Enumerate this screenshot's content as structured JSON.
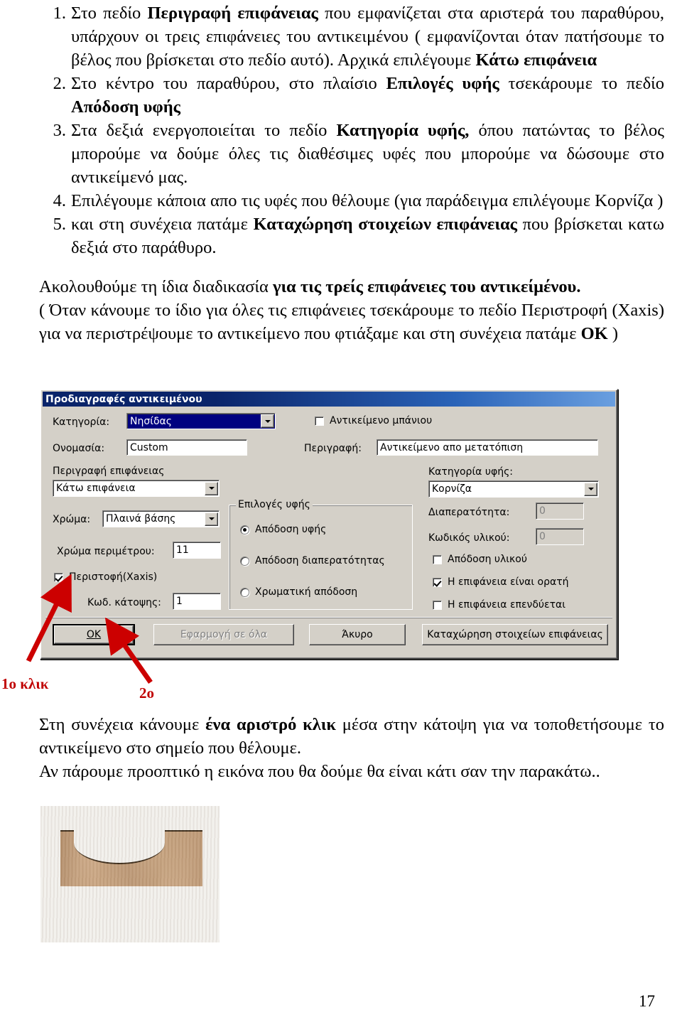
{
  "document": {
    "numbered_items": [
      {
        "number": "1.",
        "segments": [
          {
            "text": "Στο πεδίο ",
            "bold": false
          },
          {
            "text": "Περιγραφή επιφάνειας",
            "bold": true
          },
          {
            "text": " που εμφανίζεται στα αριστερά του παραθύρου, υπάρχουν οι τρεις επιφάνειες του αντικειμένου ( εμφανίζονται όταν πατήσουμε το βέλος που βρίσκεται στο πεδίο αυτό). Αρχικά επιλέγουμε ",
            "bold": false
          },
          {
            "text": "Κάτω επιφάνεια",
            "bold": true
          }
        ]
      },
      {
        "number": "2.",
        "segments": [
          {
            "text": "Στο κέντρο του παραθύρου, στο πλαίσιο ",
            "bold": false
          },
          {
            "text": "Επιλογές υφής",
            "bold": true
          },
          {
            "text": " τσεκάρουμε το πεδίο ",
            "bold": false
          },
          {
            "text": "Απόδοση υφής",
            "bold": true
          }
        ]
      },
      {
        "number": "3.",
        "segments": [
          {
            "text": "Στα δεξιά ενεργοποιείται το πεδίο ",
            "bold": false
          },
          {
            "text": "Κατηγορία υφής,",
            "bold": true
          },
          {
            "text": " όπου πατώντας το βέλος μπορούμε να δούμε όλες τις διαθέσιμες υφές που μπορούμε να δώσουμε στο αντικείμενό μας.",
            "bold": false
          }
        ]
      },
      {
        "number": "4.",
        "segments": [
          {
            "text": "Επιλέγουμε κάποια απο τις υφές που θέλουμε (για παράδειγμα επιλέγουμε Κορνίζα )",
            "bold": false
          }
        ]
      },
      {
        "number": "5.",
        "segments": [
          {
            "text": "και στη συνέχεια πατάμε ",
            "bold": false
          },
          {
            "text": "Καταχώρηση στοιχείων επιφάνειας",
            "bold": true
          },
          {
            "text": " που βρίσκεται κατω δεξιά στο παράθυρο.",
            "bold": false
          }
        ]
      }
    ],
    "paragraph_after_list": [
      {
        "segments": [
          {
            "text": "Ακολουθούμε τη ίδια διαδικασία ",
            "bold": false
          },
          {
            "text": "για τις τρείς επιφάνειες του αντικείμένου.",
            "bold": true
          }
        ]
      },
      {
        "segments": [
          {
            "text": "( Όταν κάνουμε το ίδιο για όλες τις επιφάνειες τσεκάρουμε το πεδίο Περιστροφή (Xaxis) για να περιστρέψουμε το αντικείμενο που φτιάξαμε και στη συνέχεια πατάμε ",
            "bold": false
          },
          {
            "text": "ΟΚ",
            "bold": true
          },
          {
            "text": "  )",
            "bold": false
          }
        ]
      }
    ],
    "paragraph_after_dialog": [
      {
        "segments": [
          {
            "text": "Στη συνέχεια κάνουμε ",
            "bold": false
          },
          {
            "text": "ένα αριστρό κλικ",
            "bold": true
          },
          {
            "text": " μέσα στην κάτοψη για να τοποθετήσουμε το αντικείμενο στο σημείο που θέλουμε.",
            "bold": false
          }
        ]
      },
      {
        "segments": [
          {
            "text": "Αν πάρουμε προοπτικό η εικόνα που θα δούμε θα είναι κάτι σαν την παρακάτω..",
            "bold": false
          }
        ]
      }
    ],
    "page_number": "17"
  },
  "dialog": {
    "title": "Προδιαγραφές αντικειμένου",
    "fields": {
      "category_label": "Κατηγορία:",
      "category_value": "Νησίδας",
      "bath_object_checkbox_label": "Αντικείμενο μπάνιου",
      "bath_object_checked": false,
      "name_label": "Ονομασία:",
      "name_value": "Custom",
      "description_label": "Περιγραφή:",
      "description_value": "Αντικείμενο απο μετατόπιση",
      "surface_description_label": "Περιγραφή επιφάνειας",
      "surface_description_value": "Κάτω επιφάνεια",
      "color_label": "Χρώμα:",
      "color_value": "Πλαινά βάσης",
      "perimeter_color_label": "Χρώμα περιμέτρου:",
      "perimeter_color_value": "11",
      "rotation_checkbox_label": "Περιστοφή(Xaxis)",
      "rotation_checked": true,
      "plan_code_label": "Κωδ. κάτοψης:",
      "plan_code_value": "1"
    },
    "texture_group": {
      "title": "Επιλογές υφής",
      "options": [
        {
          "label": "Απόδοση υφής",
          "selected": true
        },
        {
          "label": "Απόδοση διαπερατότητας",
          "selected": false
        },
        {
          "label": "Χρωματική απόδοση",
          "selected": false
        }
      ]
    },
    "texture_panel": {
      "category_label": "Κατηγορία υφής:",
      "category_value": "Κορνίζα",
      "transparency_label": "Διαπερατότητα:",
      "transparency_value": "0",
      "material_code_label": "Κωδικός υλικού:",
      "material_code_value": "0",
      "checkboxes": [
        {
          "label": "Απόδοση υλικού",
          "checked": false
        },
        {
          "label": "Η επιφάνεια είναι ορατή",
          "checked": true
        },
        {
          "label": "Η επιφάνεια επενδύεται",
          "checked": false
        }
      ]
    },
    "buttons": [
      {
        "label": "ΟΚ",
        "underline_index": 0,
        "state": "default"
      },
      {
        "label": "Εφαρμογή σε όλα",
        "state": "disabled"
      },
      {
        "label": "Άκυρο",
        "state": "normal"
      },
      {
        "label": "Καταχώρηση στοιχείων επιφάνειας",
        "state": "normal"
      }
    ]
  },
  "annotations": {
    "first_click": "1ο κλικ",
    "second_click": "2ο",
    "arrow_color": "#cc0000"
  },
  "colors": {
    "dialog_face": "#d4d0c8",
    "titlebar_start": "#0a246a",
    "titlebar_end": "#6a9fe0",
    "selection_blue": "#000080",
    "annotation_red": "#cc0000",
    "wood": "#c9a582"
  }
}
